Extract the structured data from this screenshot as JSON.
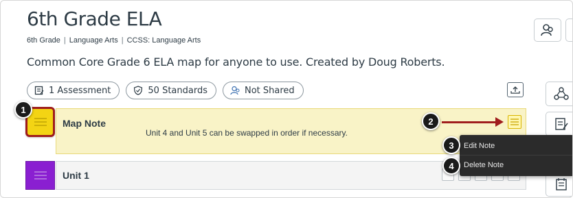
{
  "header": {
    "title": "6th Grade ELA",
    "breadcrumb": [
      "6th Grade",
      "Language Arts",
      "CCSS: Language Arts"
    ],
    "breadcrumb_separator": "|",
    "description": "Common Core Grade 6 ELA map for anyone to use. Created by Doug Roberts."
  },
  "pills": [
    {
      "label": "1 Assessment",
      "icon": "assessment-icon"
    },
    {
      "label": "50 Standards",
      "icon": "shield-check-icon"
    },
    {
      "label": "Not Shared",
      "icon": "share-user-icon"
    }
  ],
  "map_note": {
    "title": "Map Note",
    "text": "Unit 4 and Unit 5 can be swapped in order if necessary.",
    "color": "#f3d414"
  },
  "unit": {
    "title": "Unit 1",
    "color": "#8a1fd1"
  },
  "note_menu": {
    "items": [
      "Edit Note",
      "Delete Note"
    ]
  },
  "callouts": [
    "1",
    "2",
    "3",
    "4"
  ],
  "colors": {
    "accent_red": "#a01d1d",
    "menu_bg": "#2b2b2b"
  }
}
